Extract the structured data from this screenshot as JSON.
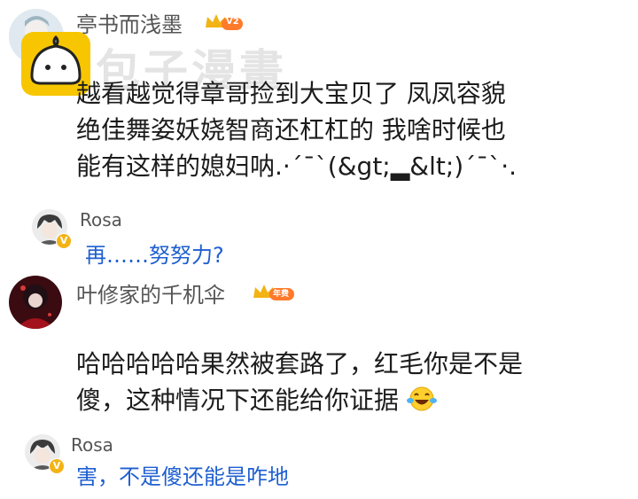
{
  "watermark": {
    "text": "包子漫畫"
  },
  "comment1": {
    "username": "亭书而浅墨",
    "level_badge": "V2",
    "lines": [
      "越看越觉得章哥捡到大宝贝了  凤凤容貌",
      "绝佳舞姿妖娆智商还杠杠的  我啥时候也",
      "能有这样的媳妇呐.·´¯`(&gt;▂&lt;)´¯`·."
    ]
  },
  "reply1": {
    "username": "Rosa",
    "verified_badge": "V",
    "text": "再……努努力?"
  },
  "comment2": {
    "username": "叶修家的千机伞",
    "level_badge": "年费",
    "lines": [
      "哈哈哈哈哈果然被套路了，红毛你是不是",
      "傻，这种情况下还能给你证据"
    ],
    "emoji": "laughing-with-tears-icon"
  },
  "reply2": {
    "username": "Rosa",
    "verified_badge": "V",
    "text": "害，不是傻还能是咋地"
  },
  "colors": {
    "reply_text": "#1f5fd0",
    "badge_gold": "#f3b315",
    "badge_orange": "#ff7a2a",
    "watermark_yellow": "#f7c600"
  }
}
